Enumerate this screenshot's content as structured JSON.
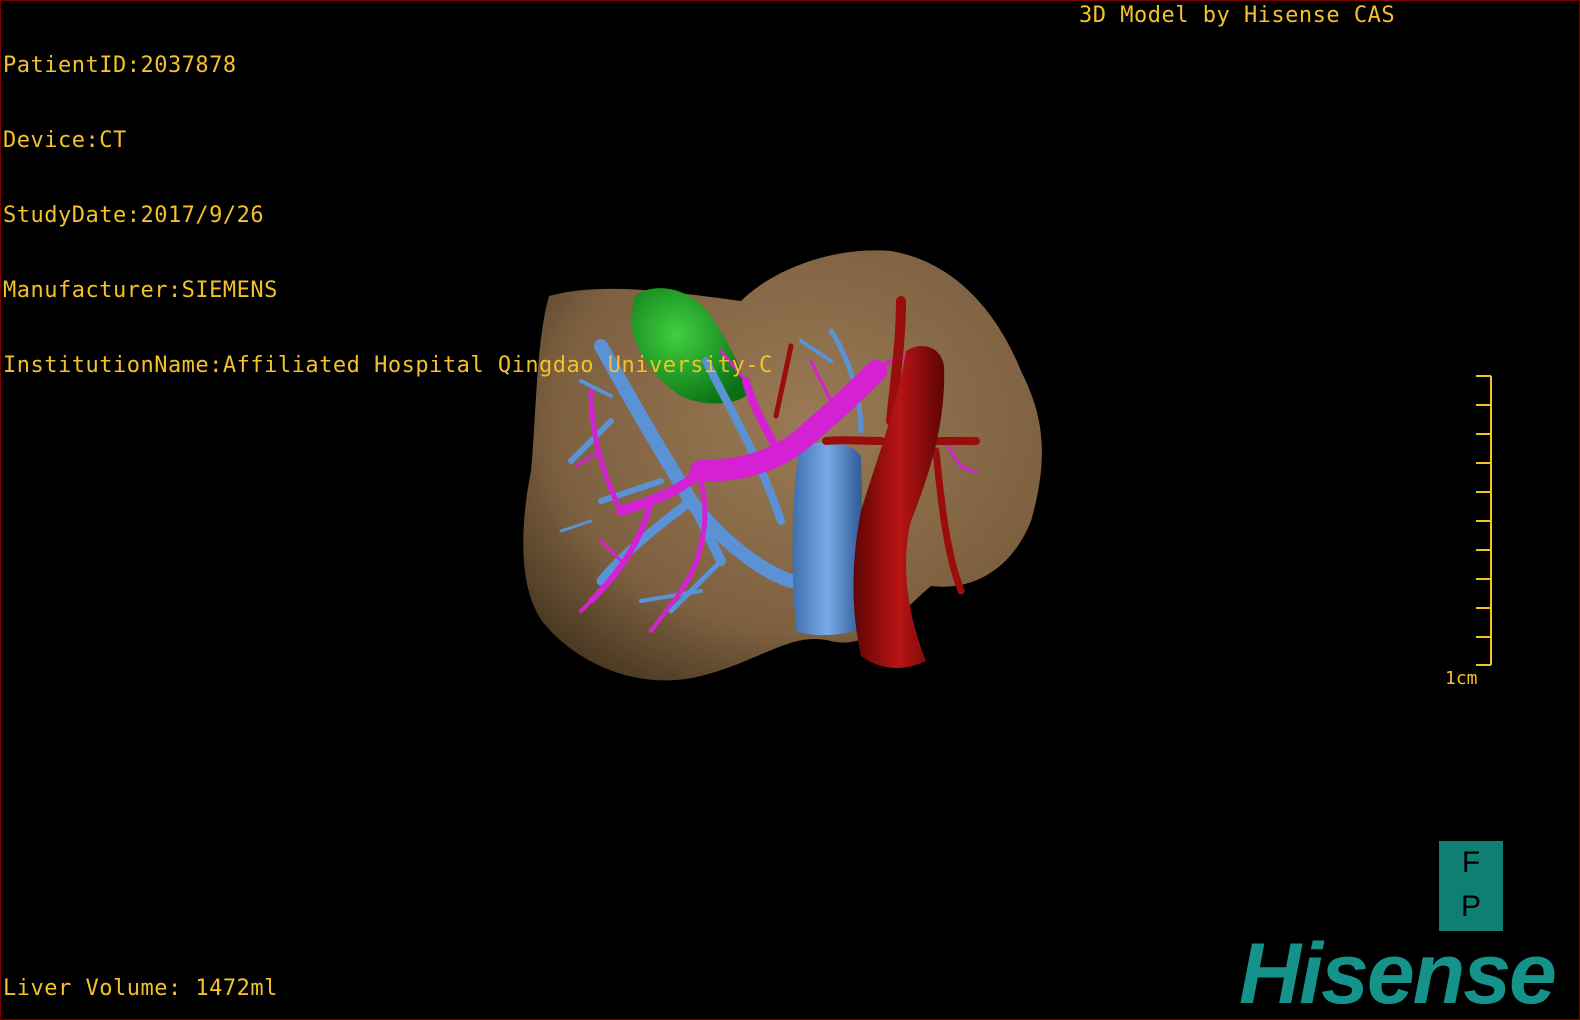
{
  "info": {
    "patient_id": "PatientID:2037878",
    "device": "Device:CT",
    "study_date": "StudyDate:2017/9/26",
    "manufacturer": "Manufacturer:SIEMENS",
    "institution": "InstitutionName:Affiliated Hospital Qingdao University-C"
  },
  "brand_text": "3D Model by Hisense CAS",
  "liver_volume": "Liver Volume: 1472ml",
  "scale_bar": {
    "label": "1cm"
  },
  "orientation": {
    "top": "F",
    "bottom": "P"
  },
  "logo": "Hisense",
  "colors": {
    "overlay_text": "#f3c12a",
    "liver": "#8a6a48",
    "gallbladder": "#1c9c23",
    "portal_vein": "#d621d6",
    "hepatic_vein": "#5a8fd0",
    "artery": "#9a0d0d",
    "logo": "#15938a"
  }
}
